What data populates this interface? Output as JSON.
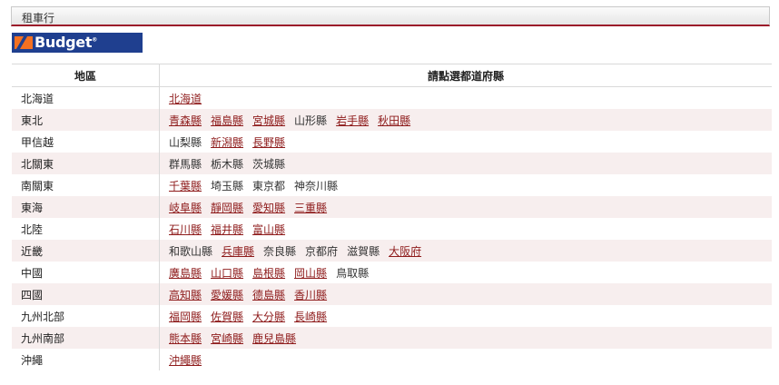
{
  "header": {
    "title": "租車行"
  },
  "brand": {
    "logo_text": "Budget",
    "logo_bg": "#1f3f8f",
    "logo_mark": "#f37021"
  },
  "table": {
    "headers": {
      "region": "地區",
      "prefecture": "請點選都道府縣"
    },
    "rows": [
      {
        "region": "北海道",
        "prefectures": [
          {
            "name": "北海道",
            "link": true
          }
        ]
      },
      {
        "region": "東北",
        "prefectures": [
          {
            "name": "青森縣",
            "link": true
          },
          {
            "name": "福島縣",
            "link": true
          },
          {
            "name": "宮城縣",
            "link": true
          },
          {
            "name": "山形縣",
            "link": false
          },
          {
            "name": "岩手縣",
            "link": true
          },
          {
            "name": "秋田縣",
            "link": true
          }
        ]
      },
      {
        "region": "甲信越",
        "prefectures": [
          {
            "name": "山梨縣",
            "link": false
          },
          {
            "name": "新潟縣",
            "link": true
          },
          {
            "name": "長野縣",
            "link": true
          }
        ]
      },
      {
        "region": "北關東",
        "prefectures": [
          {
            "name": "群馬縣",
            "link": false
          },
          {
            "name": "栃木縣",
            "link": false
          },
          {
            "name": "茨城縣",
            "link": false
          }
        ]
      },
      {
        "region": "南關東",
        "prefectures": [
          {
            "name": "千葉縣",
            "link": true
          },
          {
            "name": "埼玉縣",
            "link": false
          },
          {
            "name": "東京都",
            "link": false
          },
          {
            "name": "神奈川縣",
            "link": false
          }
        ]
      },
      {
        "region": "東海",
        "prefectures": [
          {
            "name": "岐阜縣",
            "link": true
          },
          {
            "name": "靜岡縣",
            "link": true
          },
          {
            "name": "愛知縣",
            "link": true
          },
          {
            "name": "三重縣",
            "link": true
          }
        ]
      },
      {
        "region": "北陸",
        "prefectures": [
          {
            "name": "石川縣",
            "link": true
          },
          {
            "name": "福井縣",
            "link": true
          },
          {
            "name": "富山縣",
            "link": true
          }
        ]
      },
      {
        "region": "近畿",
        "prefectures": [
          {
            "name": "和歌山縣",
            "link": false
          },
          {
            "name": "兵庫縣",
            "link": true
          },
          {
            "name": "奈良縣",
            "link": false
          },
          {
            "name": "京都府",
            "link": false
          },
          {
            "name": "滋賀縣",
            "link": false
          },
          {
            "name": "大阪府",
            "link": true
          }
        ]
      },
      {
        "region": "中國",
        "prefectures": [
          {
            "name": "廣島縣",
            "link": true
          },
          {
            "name": "山口縣",
            "link": true
          },
          {
            "name": "島根縣",
            "link": true
          },
          {
            "name": "岡山縣",
            "link": true
          },
          {
            "name": "鳥取縣",
            "link": false
          }
        ]
      },
      {
        "region": "四國",
        "prefectures": [
          {
            "name": "高知縣",
            "link": true
          },
          {
            "name": "愛媛縣",
            "link": true
          },
          {
            "name": "德島縣",
            "link": true
          },
          {
            "name": "香川縣",
            "link": true
          }
        ]
      },
      {
        "region": "九州北部",
        "prefectures": [
          {
            "name": "福岡縣",
            "link": true
          },
          {
            "name": "佐賀縣",
            "link": true
          },
          {
            "name": "大分縣",
            "link": true
          },
          {
            "name": "長崎縣",
            "link": true
          }
        ]
      },
      {
        "region": "九州南部",
        "prefectures": [
          {
            "name": "熊本縣",
            "link": true
          },
          {
            "name": "宮崎縣",
            "link": true
          },
          {
            "name": "鹿兒島縣",
            "link": true
          }
        ]
      },
      {
        "region": "沖繩",
        "prefectures": [
          {
            "name": "沖繩縣",
            "link": true
          }
        ]
      }
    ]
  }
}
